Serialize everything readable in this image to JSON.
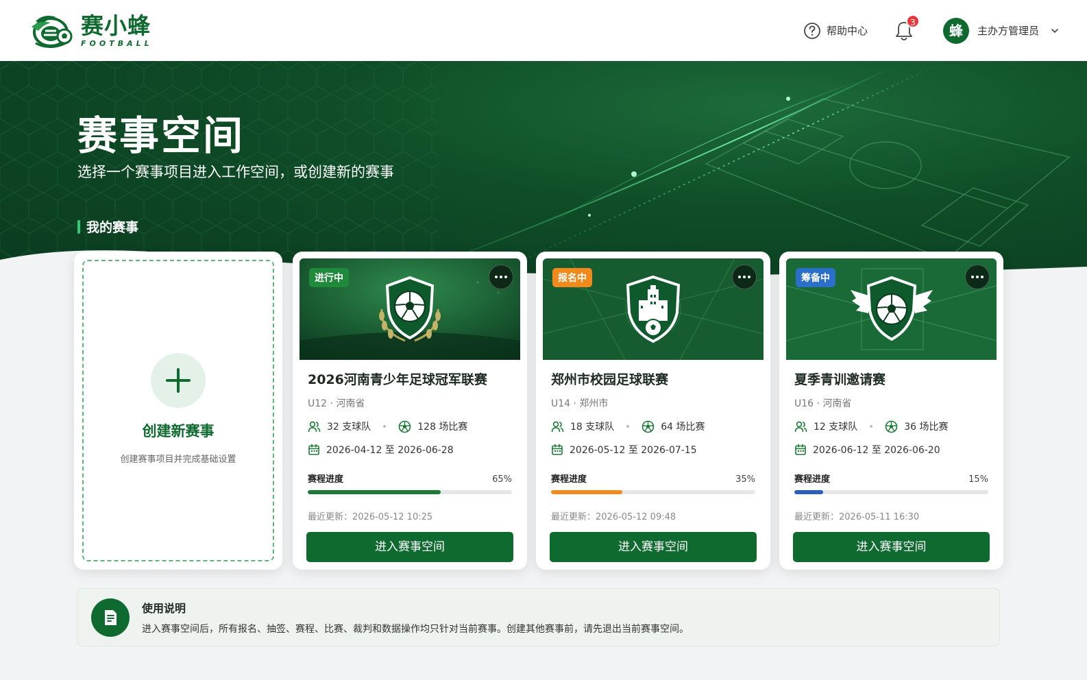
{
  "brand": {
    "name": "赛小蜂",
    "subtitle": "FOOTBALL",
    "color": "#0f6a30"
  },
  "header": {
    "help_label": "帮助中心",
    "help_icon": "question-circle-icon",
    "notification_icon": "bell-icon",
    "notification_count": "3",
    "avatar_text": "蜂",
    "user_name": "主办方管理员",
    "user_menu_icon": "chevron-down-icon"
  },
  "hero": {
    "title": "赛事空间",
    "subtitle": "选择一个赛事项目进入工作空间，或创建新的赛事",
    "section_title": "我的赛事"
  },
  "create_card": {
    "title": "创建新赛事",
    "description": "创建赛事项目并完成基础设置",
    "icon": "plus-icon"
  },
  "competitions": [
    {
      "status": "进行中",
      "status_color": "#1f8a3c",
      "emblem": "shield-football-laurel-icon",
      "title": "2026河南青少年足球冠军联赛",
      "meta": "U12 · 河南省",
      "teams": "32 支球队",
      "matches": "128 场比赛",
      "dates": "2026-04-12 至 2026-06-28",
      "progress_label": "赛程进度",
      "progress_text": "65%",
      "progress": 0.65,
      "progress_color": "#1a7a35",
      "updated": "最近更新：2026-05-12 10:25",
      "button": "进入赛事空间"
    },
    {
      "status": "报名中",
      "status_color": "#f08a1c",
      "emblem": "shield-building-icon",
      "title": "郑州市校园足球联赛",
      "meta": "U14 · 郑州市",
      "teams": "18 支球队",
      "matches": "64 场比赛",
      "dates": "2026-05-12 至 2026-07-15",
      "progress_label": "赛程进度",
      "progress_text": "35%",
      "progress": 0.35,
      "progress_color": "#f08a1c",
      "updated": "最近更新：2026-05-12 09:48",
      "button": "进入赛事空间"
    },
    {
      "status": "筹备中",
      "status_color": "#2a6fc9",
      "emblem": "winged-shield-football-icon",
      "title": "夏季青训邀请赛",
      "meta": "U16 · 河南省",
      "teams": "12 支球队",
      "matches": "36 场比赛",
      "dates": "2026-06-12 至 2026-06-20",
      "progress_label": "赛程进度",
      "progress_text": "15%",
      "progress": 0.15,
      "progress_color": "#2a5fbf",
      "updated": "最近更新：2026-05-11 16:30",
      "button": "进入赛事空间"
    }
  ],
  "notice": {
    "icon": "document-icon",
    "title": "使用说明",
    "text": "进入赛事空间后，所有报名、抽签、赛程、比赛、裁判和数据操作均只针对当前赛事。创建其他赛事前，请先退出当前赛事空间。"
  }
}
